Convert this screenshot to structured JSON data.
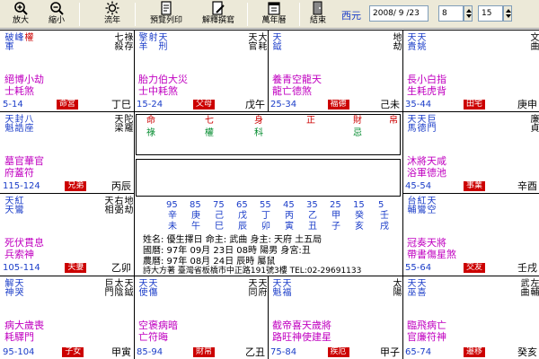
{
  "toolbar": {
    "zoom_in": "放大",
    "zoom_out": "縮小",
    "flow_year": "流年",
    "preview_print": "預覽列印",
    "interpret": "解釋撰寫",
    "calendar": "萬年曆",
    "close": "結束",
    "era_label": "西元",
    "date_value": "2008/ 9 /23",
    "hour_value": "8",
    "minute_value": "15"
  },
  "palaces": {
    "top0": {
      "stars": [
        "破軍",
        "峰",
        "權"
      ],
      "stars_r": [
        "祿存",
        "七殺"
      ],
      "line1": "絕博小劫",
      "line2": "士耗煞",
      "range": "5-14",
      "tag": "命宮",
      "branch": "丁巳"
    },
    "top1": {
      "stars": [
        "擎羊",
        "射",
        "天刑"
      ],
      "stars_r": [
        "大耗",
        "天官"
      ],
      "line1": "胎力伯大災",
      "line2": "士中耗煞",
      "range": "15-24",
      "tag": "父母",
      "branch": "戊午"
    },
    "top2": {
      "stars": [
        "天鉞"
      ],
      "stars_r": [
        "地劫"
      ],
      "line1": "養青空龍天",
      "line2": "龍亡德煞",
      "range": "25-34",
      "tag": "福德",
      "branch": "己未"
    },
    "top3": {
      "stars": [
        "天貴",
        "天姚"
      ],
      "stars_r": [
        "文曲"
      ],
      "line1": "長小白指",
      "line2": "生耗虎背",
      "range": "35-44",
      "tag": "田宅",
      "branch": "庚申"
    },
    "left1": {
      "stars": [
        "天魁",
        "封誥",
        "八座"
      ],
      "stars_r": [
        "陀羅",
        "天梁"
      ],
      "line1": "墓官華官",
      "line2": "府蓋符",
      "range": "115-124",
      "tag": "兄弟",
      "branch": "丙辰"
    },
    "right1": {
      "stars": [
        "天馬",
        "天德",
        "巨門"
      ],
      "stars_r": [
        "廉貞"
      ],
      "line1": "沐將天咸",
      "line2": "浴軍德池",
      "range": "45-54",
      "tag": "事業",
      "branch": "辛酉"
    },
    "left2": {
      "stars": [
        "天天",
        "紅鸞"
      ],
      "stars_r": [
        "地劫",
        "右弼",
        "天相"
      ],
      "line1": "死伏貫息",
      "line2": "兵索神",
      "range": "105-114",
      "tag": "夫妻",
      "branch": "乙卯"
    },
    "right2": {
      "stars": [
        "台輔",
        "紅鸞",
        "天空"
      ],
      "stars_r": [],
      "line1": "冠奏天將",
      "line2": "帶書傷星煞",
      "range": "55-64",
      "tag": "交友",
      "branch": "壬戌"
    },
    "bot0": {
      "stars": [
        "解神",
        "天哭"
      ],
      "stars_r": [
        "天鉞",
        "太陰",
        "巨門"
      ],
      "line1": "病大歲喪",
      "line2": "耗驛門",
      "range": "95-104",
      "tag": "子女",
      "branch": "甲寅"
    },
    "bot1": {
      "stars": [
        "天使",
        "天傷"
      ],
      "stars_r": [
        "天府",
        "天同"
      ],
      "line1": "空褒病暗",
      "line2": "亡符晦",
      "range": "85-94",
      "tag": "財帛",
      "branch": "乙丑"
    },
    "bot2": {
      "stars": [
        "天魁",
        "天福"
      ],
      "stars_r": [
        "太陽"
      ],
      "line1": "截帝喜天歲將",
      "line2": "路旺神使建星",
      "range": "75-84",
      "tag": "疾厄",
      "branch": "甲子"
    },
    "bot3": {
      "stars": [
        "天巫",
        "天喜"
      ],
      "stars_r": [
        "左輔",
        "武曲"
      ],
      "line1": "臨飛病亡",
      "line2": "官廉符神",
      "range": "65-74",
      "tag": "遷移",
      "branch": "癸亥"
    }
  },
  "center": {
    "heads": [
      "命",
      "七",
      "身",
      "正",
      "財",
      "帛"
    ],
    "trans": [
      "祿",
      "權",
      "科",
      "忌"
    ],
    "numbers": [
      "95",
      "85",
      "75",
      "65",
      "55",
      "45",
      "35",
      "25",
      "15",
      "5"
    ],
    "stems": [
      "辛",
      "庚",
      "己",
      "戊",
      "丁",
      "丙",
      "乙",
      "甲",
      "癸",
      "壬"
    ],
    "branches": [
      "未",
      "午",
      "巳",
      "辰",
      "卯",
      "寅",
      "丑",
      "子",
      "亥",
      "戌"
    ],
    "name_line": "姓名: 優生擇日    命主: 武曲    身主: 天府    土五局",
    "solar_line": "國曆:   97年   09月  23日   08時    陽男   身宮:丑",
    "lunar_line": "農曆:   97年   08月  24日   辰時    屬鼠",
    "company_line": "詩大方著  臺灣省板橋市中正路191號3樓  TEL:02-29691133"
  },
  "colors": {
    "blue": "#1a3cc8",
    "red": "#cc0000",
    "green": "#008a2c",
    "magenta": "#c000c0",
    "toolbar_bg": "#ece9d8"
  }
}
